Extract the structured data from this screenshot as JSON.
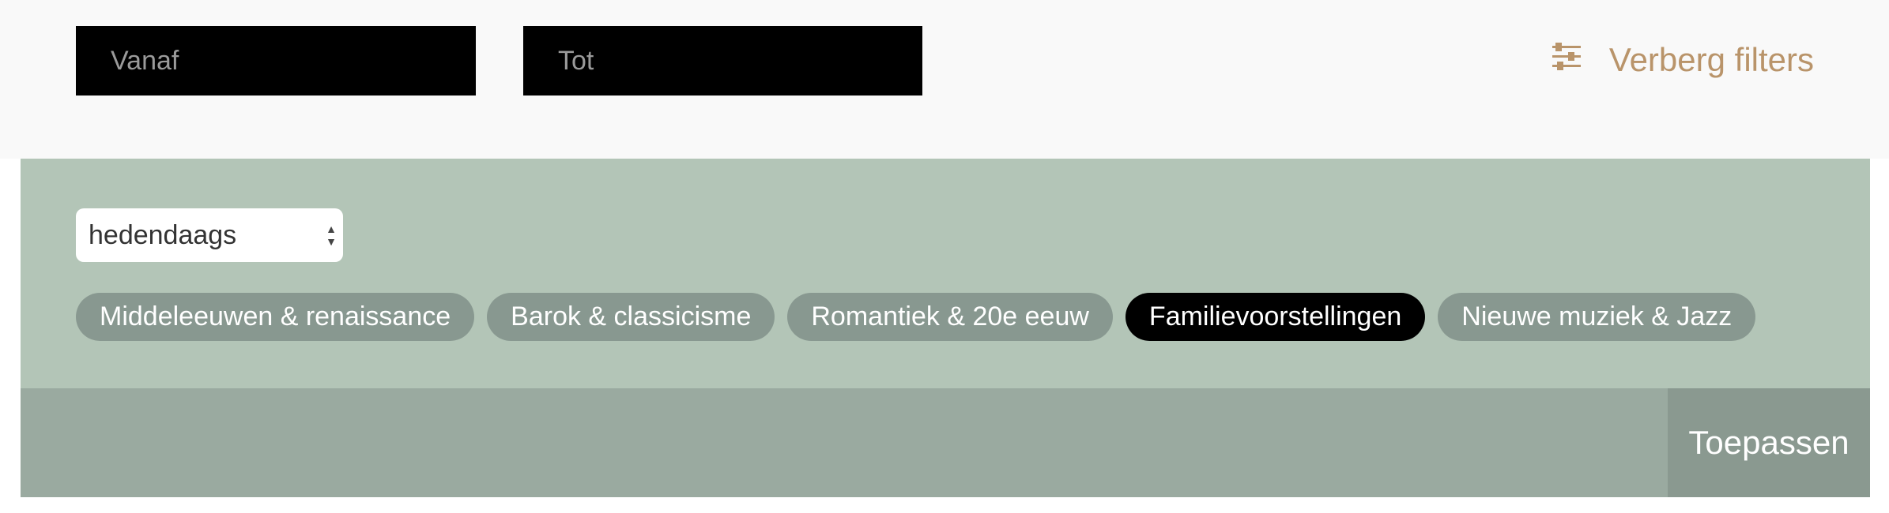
{
  "date_filters": {
    "from_placeholder": "Vanaf",
    "to_placeholder": "Tot"
  },
  "toggle": {
    "label": "Verberg filters",
    "icon": "sliders-icon",
    "color": "#b9946a"
  },
  "genre_select": {
    "value": "hedendaags"
  },
  "categories": [
    {
      "label": "Middeleeuwen & renaissance",
      "active": false
    },
    {
      "label": "Barok & classicisme",
      "active": false
    },
    {
      "label": "Romantiek & 20e eeuw",
      "active": false
    },
    {
      "label": "Familievoorstellingen",
      "active": true
    },
    {
      "label": "Nieuwe muziek & Jazz",
      "active": false
    }
  ],
  "apply": {
    "label": "Toepassen"
  },
  "colors": {
    "panel": "#b3c5b7",
    "chip": "#889890",
    "chip_active": "#000000",
    "apply_bar": "#9aaaa0"
  }
}
